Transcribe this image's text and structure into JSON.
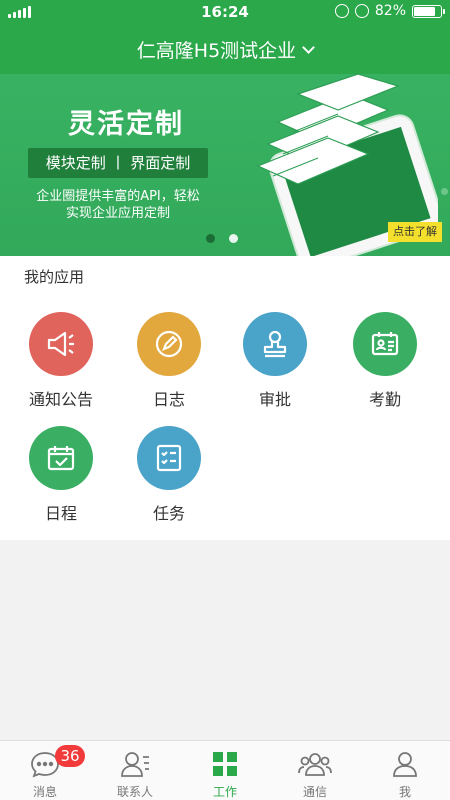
{
  "status_bar": {
    "time": "16:24",
    "battery": "82%",
    "battery_level": 0.82
  },
  "header": {
    "title": "仁高隆H5测试企业"
  },
  "banner": {
    "title": "灵活定制",
    "tag": "模块定制 丨 界面定制",
    "desc_line1": "企业圈提供丰富的API，轻松",
    "desc_line2": "实现企业应用定制",
    "button": "点击了解"
  },
  "apps": {
    "section_title": "我的应用",
    "items": [
      {
        "label": "通知公告",
        "icon": "megaphone-icon",
        "color": "#e0645c"
      },
      {
        "label": "日志",
        "icon": "pencil-icon",
        "color": "#e2a83e"
      },
      {
        "label": "审批",
        "icon": "stamp-icon",
        "color": "#4aa3c8"
      },
      {
        "label": "考勤",
        "icon": "id-card-icon",
        "color": "#3aaf63"
      },
      {
        "label": "日程",
        "icon": "calendar-check-icon",
        "color": "#3aaf63"
      },
      {
        "label": "任务",
        "icon": "checklist-icon",
        "color": "#4aa3c8"
      }
    ]
  },
  "tabbar": {
    "items": [
      {
        "label": "消息",
        "icon": "chat-bubble-icon",
        "badge": "36"
      },
      {
        "label": "联系人",
        "icon": "contacts-icon"
      },
      {
        "label": "工作",
        "icon": "grid-icon",
        "active": true
      },
      {
        "label": "通信",
        "icon": "group-icon"
      },
      {
        "label": "我",
        "icon": "person-icon"
      }
    ]
  },
  "colors": {
    "brand": "#2aa84a",
    "banner": "#38b262",
    "badge": "#f23a3a"
  }
}
